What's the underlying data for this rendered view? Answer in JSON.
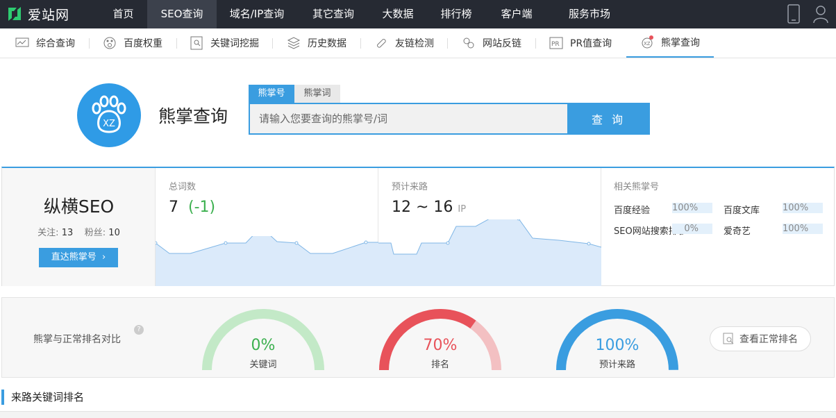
{
  "brand": {
    "name": "爱站网"
  },
  "topnav": [
    "首页",
    "SEO查询",
    "域名/IP查询",
    "其它查询",
    "大数据",
    "排行榜",
    "客户端",
    "服务市场"
  ],
  "subnav": [
    "综合查询",
    "百度权重",
    "关键词挖掘",
    "历史数据",
    "友链检测",
    "网站反链",
    "PR值查询",
    "熊掌查询"
  ],
  "search": {
    "title": "熊掌查询",
    "tabs": [
      "熊掌号",
      "熊掌词"
    ],
    "placeholder": "请输入您要查询的熊掌号/词",
    "button": "查 询",
    "logo_text": "XZ"
  },
  "profile": {
    "name": "纵横SEO",
    "follow_label": "关注:",
    "follow": "13",
    "fans_label": "粉丝:",
    "fans": "10",
    "button": "直达熊掌号"
  },
  "words": {
    "label": "总词数",
    "value": "7",
    "delta": "(-1)"
  },
  "traffic": {
    "label": "预计来路",
    "value": "12 ~ 16",
    "unit": "IP"
  },
  "related": {
    "label": "相关熊掌号",
    "items": [
      {
        "name": "百度经验",
        "pct": "100%"
      },
      {
        "name": "百度文库",
        "pct": "100%"
      },
      {
        "name": "SEO网站搜索排名",
        "pct": "0%"
      },
      {
        "name": "爱奇艺",
        "pct": "100%"
      }
    ]
  },
  "compare": {
    "label": "熊掌与正常排名对比",
    "help": "?",
    "gauges": [
      {
        "pct": "0%",
        "label": "关键词",
        "value": 0,
        "color": "#3cb04f",
        "track": "#c3e9c7"
      },
      {
        "pct": "70%",
        "label": "排名",
        "value": 0.7,
        "color": "#e8525a",
        "track": "#f3c0c2"
      },
      {
        "pct": "100%",
        "label": "预计来路",
        "value": 1,
        "color": "#3a9de0",
        "track": "#c7e2f6"
      }
    ],
    "button": "查看正常排名"
  },
  "section": {
    "title": "来路关键词排名"
  },
  "colors": {
    "accent": "#3a9de0",
    "nav_bg": "#262a33",
    "positive": "#3cb04f"
  }
}
